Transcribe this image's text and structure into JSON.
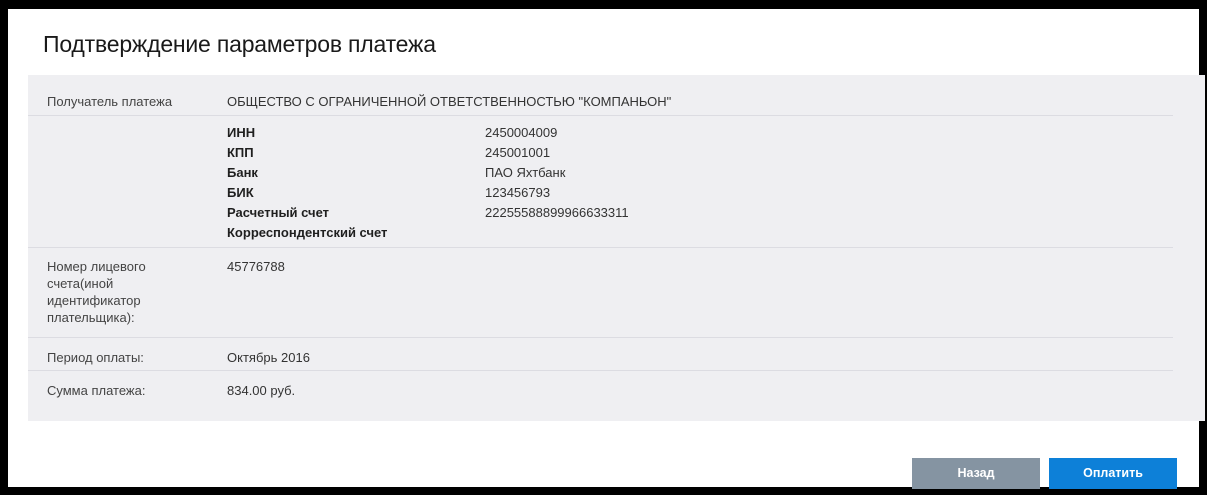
{
  "page": {
    "title": "Подтверждение параметров платежа"
  },
  "recipient": {
    "label": "Получатель платежа",
    "name": "ОБЩЕСТВО С ОГРАНИЧЕННОЙ ОТВЕТСТВЕННОСТЬЮ \"КОМПАНЬОН\""
  },
  "details": [
    {
      "key": "ИНН",
      "value": "2450004009"
    },
    {
      "key": "КПП",
      "value": "245001001"
    },
    {
      "key": "Банк",
      "value": "ПАО Яхтбанк"
    },
    {
      "key": "БИК",
      "value": "123456793"
    },
    {
      "key": "Расчетный счет",
      "value": "22255588899966633311"
    },
    {
      "key": "Корреспондентский счет",
      "value": ""
    }
  ],
  "account": {
    "label": "Номер лицевого счета(иной идентификатор плательщика):",
    "value": "45776788"
  },
  "period": {
    "label": "Период оплаты:",
    "value": "Октябрь 2016"
  },
  "amount": {
    "label": "Сумма платежа:",
    "value": "834.00 руб."
  },
  "buttons": {
    "back_label": "Назад",
    "pay_label": "Оплатить"
  }
}
